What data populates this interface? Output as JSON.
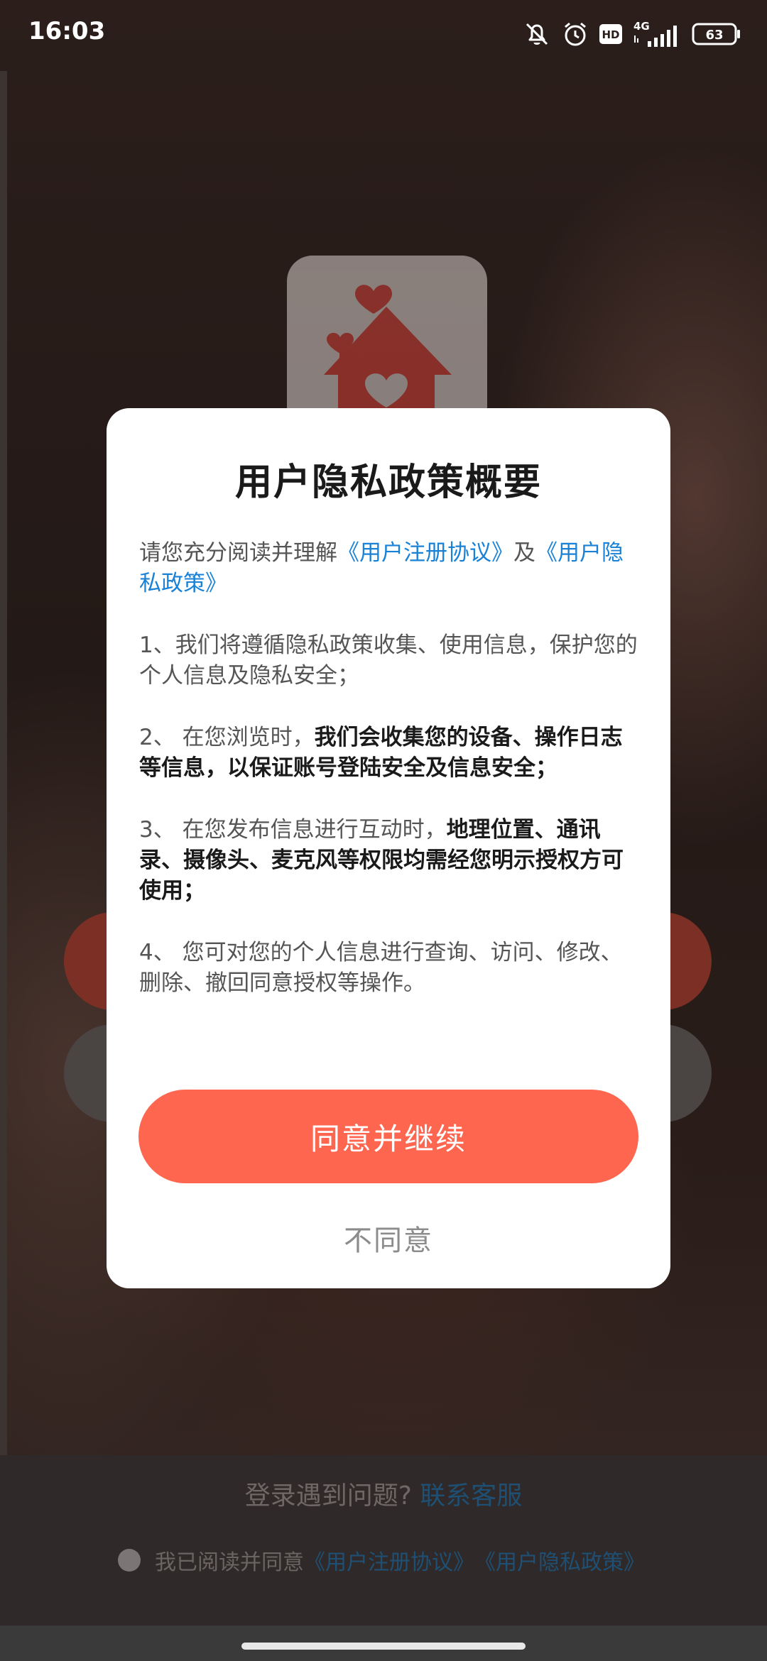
{
  "status_bar": {
    "time": "16:03",
    "network": "4G",
    "hd_label": "HD",
    "battery": "63",
    "icons": [
      "bell-muted-icon",
      "alarm-icon",
      "hd-icon",
      "signal-icon",
      "battery-icon"
    ]
  },
  "background": {
    "help_text": "登录遇到问题?",
    "help_link": "联系客服",
    "consent_prefix": "我已阅读并同意",
    "consent_link_1": "《用户注册协议》",
    "consent_link_2": "《用户隐私政策》"
  },
  "modal": {
    "title": "用户隐私政策概要",
    "intro_prefix": "请您充分阅读并理解",
    "intro_link_1": "《用户注册协议》",
    "intro_mid": "及",
    "intro_link_2": "《用户隐私政策》",
    "item1": "1、我们将遵循隐私政策收集、使用信息，保护您的个人信息及隐私安全；",
    "item2_prefix": "2、 在您浏览时，",
    "item2_bold": "我们会收集您的设备、操作日志等信息，以保证账号登陆安全及信息安全；",
    "item3_prefix": "3、 在您发布信息进行互动时，",
    "item3_bold": "地理位置、通讯录、摄像头、麦克风等权限均需经您明示授权方可使用；",
    "item4": "4、 您可对您的个人信息进行查询、访问、修改、删除、撤回同意授权等操作。",
    "agree_label": "同意并继续",
    "disagree_label": "不同意"
  },
  "colors": {
    "accent": "#ff6650",
    "link": "#1a82d6"
  }
}
